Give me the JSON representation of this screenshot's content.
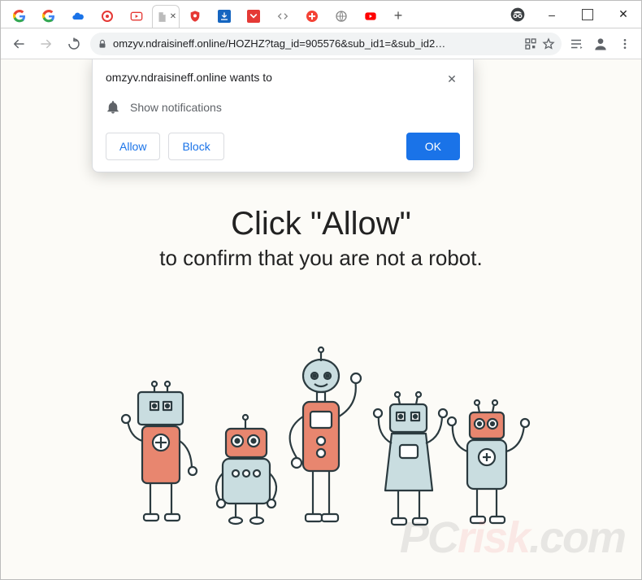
{
  "window": {
    "minimize": "–",
    "maximize": "☐",
    "close": "✕"
  },
  "tabs": {
    "new_tab_plus": "+"
  },
  "toolbar": {
    "url": "omzyv.ndraisineff.online/HOZHZ?tag_id=905576&sub_id1=&sub_id2…"
  },
  "permission": {
    "title": "omzyv.ndraisineff.online wants to",
    "line": "Show notifications",
    "allow": "Allow",
    "block": "Block",
    "ok": "OK",
    "close": "✕"
  },
  "page": {
    "heading": "Click \"Allow\"",
    "subheading": "to confirm that you are not a robot."
  },
  "watermark": {
    "a": "PC",
    "b": "risk",
    "c": ".com"
  }
}
